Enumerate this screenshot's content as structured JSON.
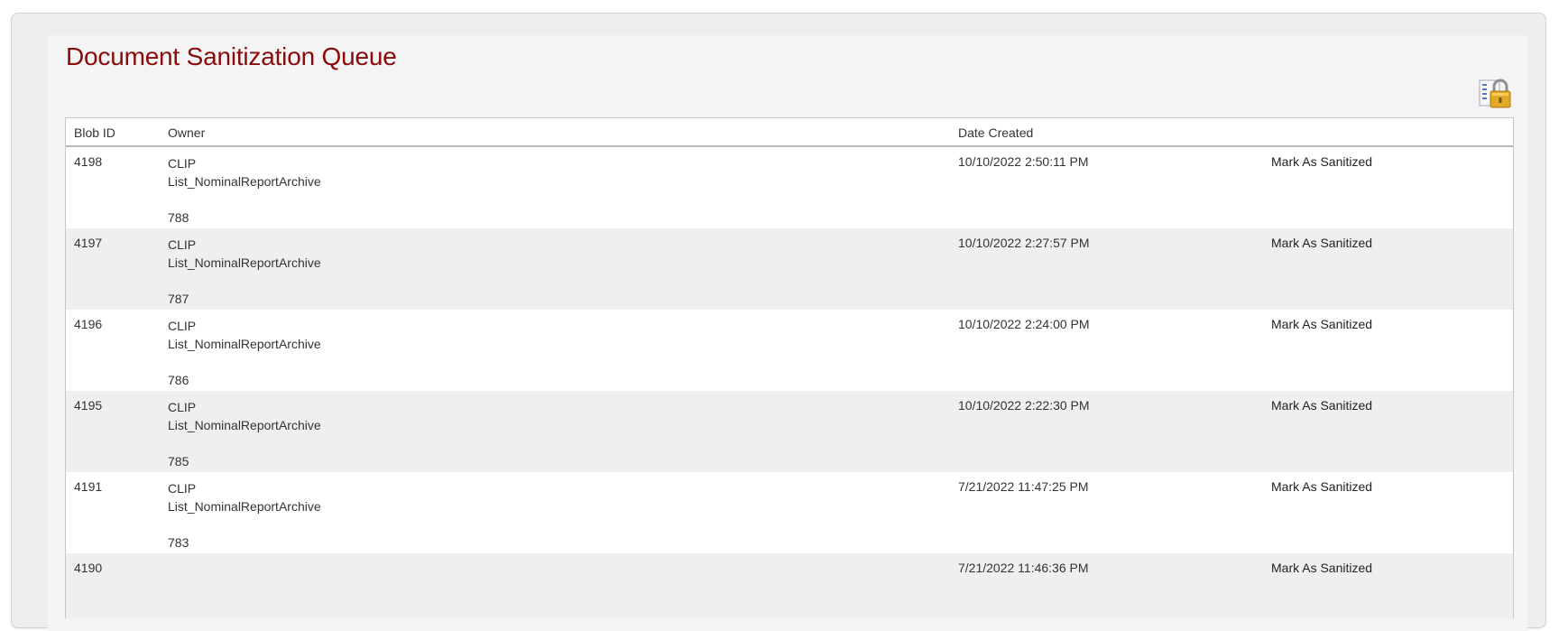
{
  "page": {
    "title": "Document Sanitization Queue",
    "lock_icon": "lock-list-icon"
  },
  "grid": {
    "columns": [
      "Blob ID",
      "Owner",
      "Date Created",
      ""
    ],
    "rows": [
      {
        "blob_id": "4198",
        "owner_type": "CLIP",
        "owner_list": "List_NominalReportArchive",
        "owner_num": "788",
        "date": "10/10/2022 2:50:11 PM",
        "action": "Mark As Sanitized"
      },
      {
        "blob_id": "4197",
        "owner_type": "CLIP",
        "owner_list": "List_NominalReportArchive",
        "owner_num": "787",
        "date": "10/10/2022 2:27:57 PM",
        "action": "Mark As Sanitized"
      },
      {
        "blob_id": "4196",
        "owner_type": "CLIP",
        "owner_list": "List_NominalReportArchive",
        "owner_num": "786",
        "date": "10/10/2022 2:24:00 PM",
        "action": "Mark As Sanitized"
      },
      {
        "blob_id": "4195",
        "owner_type": "CLIP",
        "owner_list": "List_NominalReportArchive",
        "owner_num": "785",
        "date": "10/10/2022 2:22:30 PM",
        "action": "Mark As Sanitized"
      },
      {
        "blob_id": "4191",
        "owner_type": "CLIP",
        "owner_list": "List_NominalReportArchive",
        "owner_num": "783",
        "date": "7/21/2022 11:47:25 PM",
        "action": "Mark As Sanitized"
      },
      {
        "blob_id": "4190",
        "owner_type": "",
        "owner_list": "",
        "owner_num": "",
        "date": "7/21/2022 11:46:36 PM",
        "action": "Mark As Sanitized"
      }
    ]
  },
  "colors": {
    "title": "#8b0a0a",
    "row_alt": "#efefef"
  }
}
